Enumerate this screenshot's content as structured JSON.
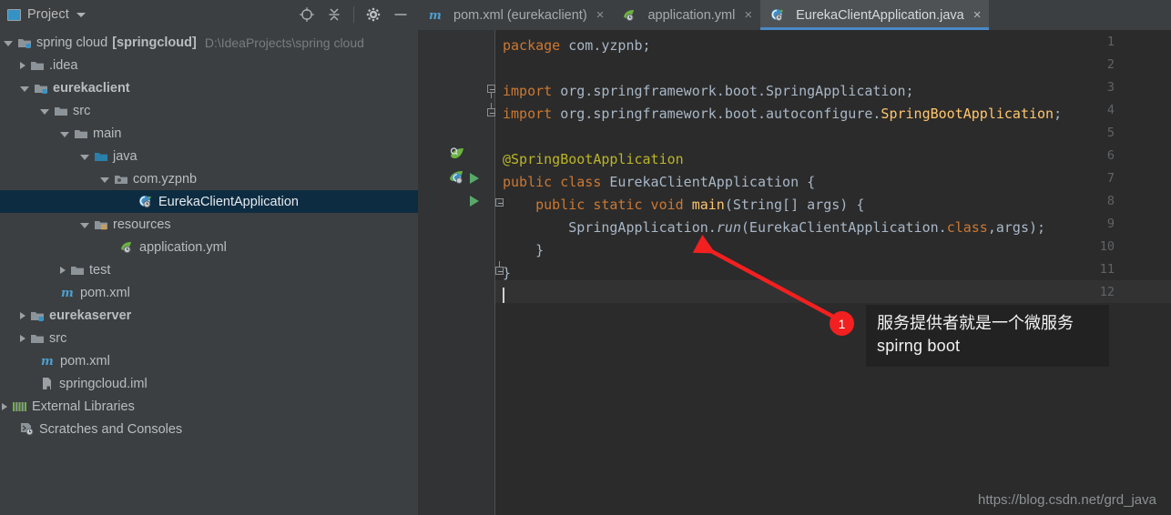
{
  "sidebar": {
    "header": {
      "title": "Project",
      "icon": "project-icon",
      "dropdown": "chevron-down-icon"
    },
    "toolbar": [
      {
        "name": "locate-icon",
        "label": "Select Opened File"
      },
      {
        "name": "collapse-all-icon",
        "label": "Collapse All"
      },
      {
        "name": "gear-icon",
        "label": "Settings"
      },
      {
        "name": "minimize-icon",
        "label": "Hide"
      }
    ],
    "tree": [
      {
        "label": "spring cloud",
        "bold_label": "[springcloud]",
        "path": "D:\\IdeaProjects\\spring cloud",
        "depth": 0,
        "toggle": "open",
        "icon": "module-folder-icon",
        "selected": false
      },
      {
        "label": ".idea",
        "depth": 1,
        "toggle": "closed",
        "icon": "folder-icon",
        "selected": false
      },
      {
        "label": "eurekaclient",
        "depth": 1,
        "toggle": "open",
        "icon": "module-folder-icon",
        "bold": true,
        "selected": false
      },
      {
        "label": "src",
        "depth": 2,
        "toggle": "open",
        "icon": "folder-icon",
        "selected": false
      },
      {
        "label": "main",
        "depth": 3,
        "toggle": "open",
        "icon": "folder-icon",
        "selected": false
      },
      {
        "label": "java",
        "depth": 4,
        "toggle": "open",
        "icon": "source-folder-icon",
        "selected": false
      },
      {
        "label": "com.yzpnb",
        "depth": 5,
        "toggle": "open",
        "icon": "package-icon",
        "selected": false
      },
      {
        "label": "EurekaClientApplication",
        "depth": 6,
        "toggle": "none",
        "icon": "spring-class-icon",
        "selected": true
      },
      {
        "label": "resources",
        "depth": 4,
        "toggle": "open",
        "icon": "resources-folder-icon",
        "selected": false
      },
      {
        "label": "application.yml",
        "depth": 5,
        "toggle": "none",
        "icon": "spring-yml-icon",
        "selected": false
      },
      {
        "label": "test",
        "depth": 3,
        "toggle": "closed",
        "icon": "folder-icon",
        "selected": false
      },
      {
        "label": "pom.xml",
        "depth": 3,
        "toggle": "none",
        "icon": "maven-icon",
        "selected": false
      },
      {
        "label": "eurekaserver",
        "depth": 1,
        "toggle": "closed",
        "icon": "module-folder-icon",
        "bold": true,
        "selected": false
      },
      {
        "label": "src",
        "depth": 1,
        "toggle": "closed",
        "icon": "folder-icon",
        "selected": false
      },
      {
        "label": "pom.xml",
        "depth": 1,
        "toggle": "none",
        "icon": "maven-icon",
        "selected": false
      },
      {
        "label": "springcloud.iml",
        "depth": 1,
        "toggle": "none",
        "icon": "iml-icon",
        "selected": false
      },
      {
        "label": "External Libraries",
        "depth": 0,
        "toggle": "closed",
        "icon": "libraries-icon",
        "selected": false
      },
      {
        "label": "Scratches and Consoles",
        "depth": 0,
        "toggle": "none",
        "icon": "scratches-icon",
        "selected": false
      }
    ]
  },
  "tabs": [
    {
      "label": "pom.xml (eurekaclient)",
      "icon": "maven-icon",
      "active": false,
      "close": "×"
    },
    {
      "label": "application.yml",
      "icon": "spring-yml-icon",
      "active": false,
      "close": "×"
    },
    {
      "label": "EurekaClientApplication.java",
      "icon": "spring-class-icon",
      "active": true,
      "close": "×"
    }
  ],
  "editor": {
    "line_numbers": [
      "1",
      "2",
      "3",
      "4",
      "5",
      "6",
      "7",
      "8",
      "9",
      "10",
      "11",
      "12"
    ],
    "lines": [
      "package com.yzpnb;",
      "",
      "import org.springframework.boot.SpringApplication;",
      "import org.springframework.boot.autoconfigure.SpringBootApplication;",
      "",
      "@SpringBootApplication",
      "public class EurekaClientApplication {",
      "    public static void main(String[] args) {",
      "        SpringApplication.run(EurekaClientApplication.class,args);",
      "    }",
      "}",
      ""
    ],
    "current_line": 12,
    "gutter_icons": [
      {
        "line": 6,
        "name": "spring-bean-icon"
      },
      {
        "line": 7,
        "name": "spring-boot-icon"
      },
      {
        "line": 7,
        "name": "run-icon"
      },
      {
        "line": 8,
        "name": "run-icon"
      }
    ],
    "watermark": "https://blog.csdn.net/grd_java"
  },
  "annotation": {
    "badge": "1",
    "line1": "服务提供者就是一个微服务",
    "line2": "spirng boot",
    "arrow_color": "#f22020"
  },
  "colors": {
    "sidebar_bg": "#3c3f41",
    "editor_bg": "#2b2b2b",
    "gutter_bg": "#313335",
    "selection_bg": "#0d2c42",
    "tab_active_bg": "#4e5254",
    "tab_underline": "#4a88c7",
    "keyword": "#cc7832",
    "annotation_text": "#bbb529",
    "class_name": "#ffc66d",
    "default_text": "#a9b7c6"
  }
}
